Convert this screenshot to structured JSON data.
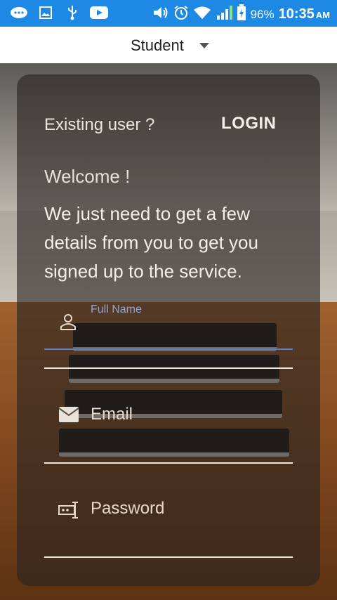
{
  "status_bar": {
    "battery_percent": "96%",
    "time": "10:35",
    "ampm": "AM",
    "left_icons": [
      "chat-icon",
      "image-icon",
      "usb-icon",
      "youtube-icon"
    ],
    "right_icons": [
      "volume-icon",
      "alarm-icon",
      "wifi-icon",
      "signal-icon",
      "battery-charging-icon"
    ],
    "color": "#1e88e5"
  },
  "role_selector": {
    "selected": "Student"
  },
  "card": {
    "existing_user_text": "Existing user ?",
    "login_label": "LOGIN",
    "welcome_text": "Welcome !",
    "intro_text": "We just need to get a few details from you to get you signed up to the service."
  },
  "form": {
    "full_name": {
      "floating_label": "Full Name",
      "value": ""
    },
    "email": {
      "placeholder": "Email",
      "value": ""
    },
    "password": {
      "placeholder": "Password",
      "value": ""
    }
  }
}
